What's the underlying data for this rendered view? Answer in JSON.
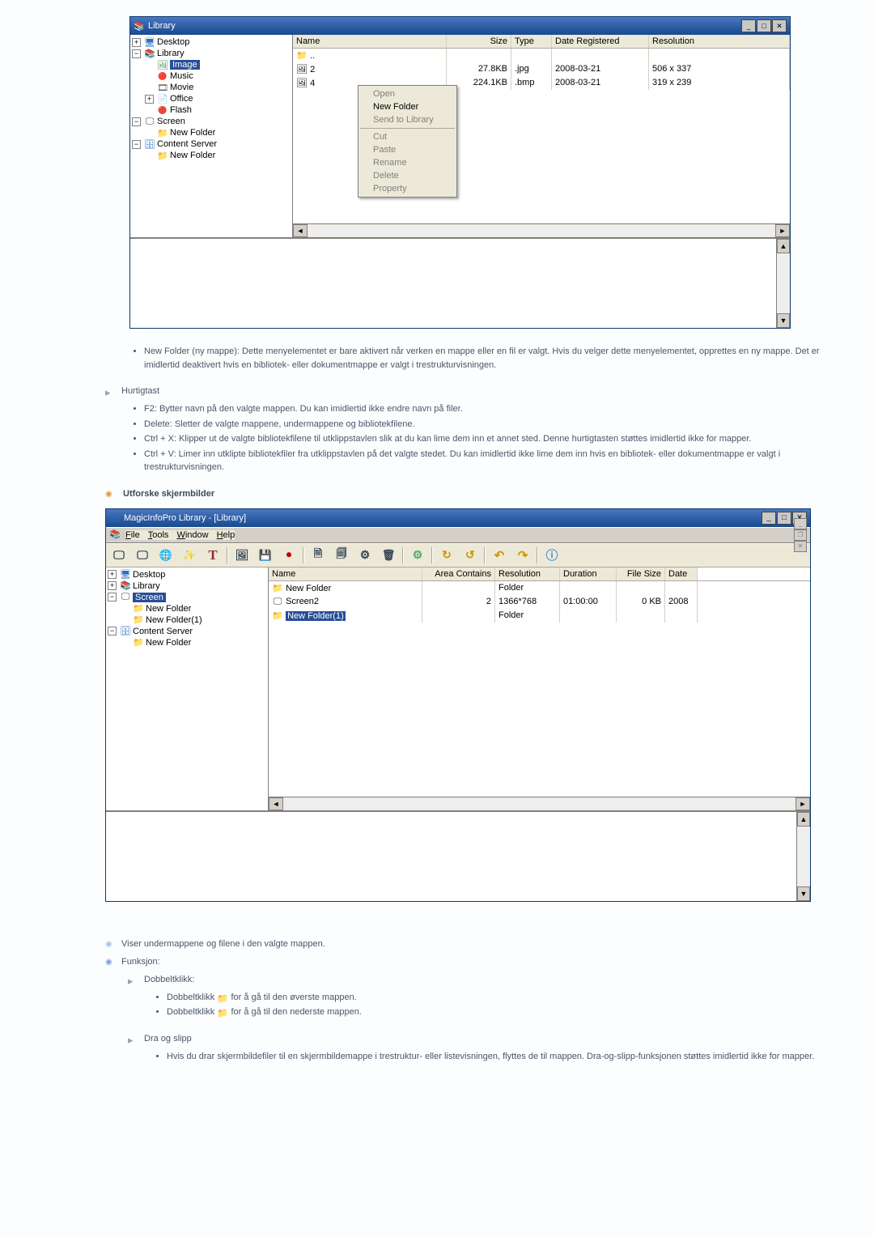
{
  "shot1": {
    "title": "Library",
    "sysbtns": {
      "min": "_",
      "max": "□",
      "close": "✕"
    },
    "tree": {
      "desktop": "Desktop",
      "library": "Library",
      "image": "Image",
      "music": "Music",
      "movie": "Movie",
      "office": "Office",
      "flash": "Flash",
      "screen": "Screen",
      "newfolder1": "New Folder",
      "content": "Content Server",
      "newfolder2": "New Folder"
    },
    "cols": {
      "name": "Name",
      "size": "Size",
      "type": "Type",
      "date": "Date Registered",
      "res": "Resolution"
    },
    "rows": [
      {
        "icon": "up",
        "name": "..",
        "size": "",
        "type": "",
        "date": "",
        "res": ""
      },
      {
        "icon": "img",
        "name": "2",
        "size": "27.8KB",
        "type": ".jpg",
        "date": "2008-03-21",
        "res": "506 x 337"
      },
      {
        "icon": "bmp",
        "name": "4",
        "size": "224.1KB",
        "type": ".bmp",
        "date": "2008-03-21",
        "res": "319 x 239"
      }
    ],
    "ctx": {
      "open": "Open",
      "newfolder": "New Folder",
      "send": "Send to Library",
      "cut": "Cut",
      "paste": "Paste",
      "rename": "Rename",
      "delete": "Delete",
      "property": "Property"
    }
  },
  "bullets_newfolder": "New Folder (ny mappe): Dette menyelementet er bare aktivert når verken en mappe eller en fil er valgt. Hvis du velger dette menyelementet, opprettes en ny mappe. Det er imidlertid deaktivert hvis en bibliotek- eller dokumentmappe er valgt i trestrukturvisningen.",
  "hurtigtast_label": "Hurtigtast",
  "hotkeys": [
    "F2: Bytter navn på den valgte mappen. Du kan imidlertid ikke endre navn på filer.",
    "Delete: Sletter de valgte mappene, undermappene og bibliotekfilene.",
    "Ctrl + X: Klipper ut de valgte bibliotekfilene til utklippstavlen slik at du kan lime dem inn et annet sted. Denne hurtigtasten støttes imidlertid ikke for mapper.",
    "Ctrl + V: Limer inn utklipte bibliotekfiler fra utklippstavlen på det valgte stedet. Du kan imidlertid ikke lime dem inn hvis en bibliotek- eller dokumentmappe er valgt i trestrukturvisningen."
  ],
  "heading2": "Utforske skjermbilder",
  "shot2": {
    "apptitle": "MagicInfoPro Library - [Library]",
    "doctitle": "",
    "menu": {
      "file": "File",
      "tools": "Tools",
      "window": "Window",
      "help": "Help"
    },
    "tree": {
      "desktop": "Desktop",
      "library": "Library",
      "screen": "Screen",
      "nf": "New Folder",
      "nf1": "New Folder(1)",
      "content": "Content Server",
      "nfc": "New Folder"
    },
    "cols": {
      "name": "Name",
      "area": "Area Contains",
      "res": "Resolution",
      "dur": "Duration",
      "fsize": "File Size",
      "date": "Date"
    },
    "rows": [
      {
        "icon": "fold",
        "name": "New Folder",
        "area": "",
        "res": "Folder",
        "dur": "",
        "fsize": "",
        "date": ""
      },
      {
        "icon": "scr",
        "name": "Screen2",
        "area": "2",
        "res": "1366*768",
        "dur": "01:00:00",
        "fsize": "0 KB",
        "date": "2008"
      },
      {
        "icon": "fold",
        "name": "New Folder(1)",
        "area": "",
        "res": "Folder",
        "dur": "",
        "fsize": "",
        "date": "",
        "selected": true
      }
    ]
  },
  "bottom_notes": {
    "viser": "Viser undermappene og filene i den valgte mappen.",
    "funksjon": "Funksjon:",
    "dobbeltklikk": "Dobbeltklikk:",
    "dk_items": [
      {
        "pre": "Dobbeltklikk",
        "icon": "up",
        "post": " for å gå til den øverste mappen."
      },
      {
        "pre": "Dobbeltklikk",
        "icon": "fold",
        "post": " for å gå til den nederste mappen."
      }
    ],
    "dragdrop_label": "Dra og slipp",
    "dragdrop_item": "Hvis du drar skjermbildefiler til en skjermbildemappe i trestruktur- eller listevisningen, flyttes de til mappen. Dra-og-slipp-funksjonen støttes imidlertid ikke for mapper."
  }
}
